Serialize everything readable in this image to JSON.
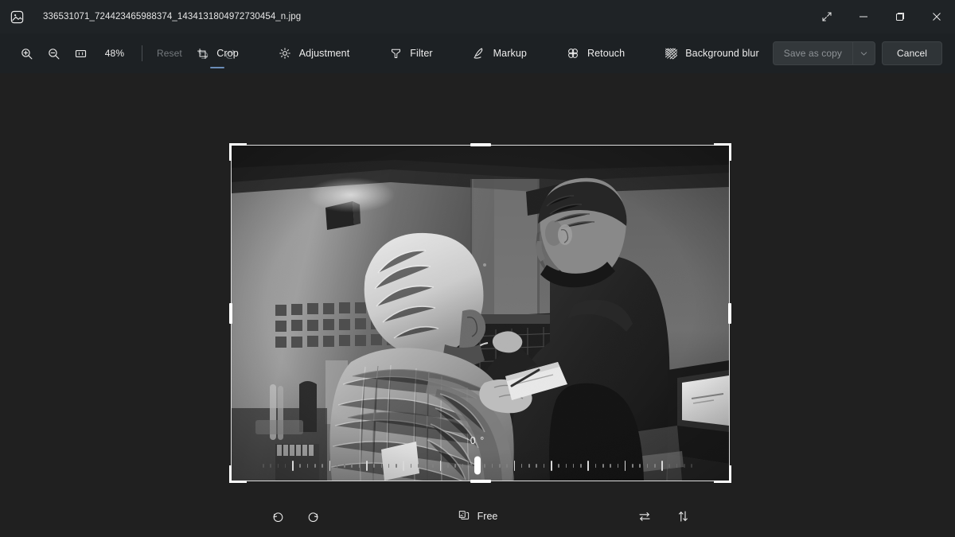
{
  "window": {
    "title": "336531071_724423465988374_1434131804972730454_n.jpg",
    "app_icon": "photo-icon",
    "expand_icon": "expand-diagonal-icon",
    "minimize_label": "─",
    "maximize_label": "❐",
    "close_label": "✕"
  },
  "toolbar": {
    "zoom_in_icon": "zoom-in-icon",
    "zoom_out_icon": "zoom-out-icon",
    "fit_icon": "fit-to-window-icon",
    "zoom_level": "48%",
    "reset_label": "Reset",
    "undo_icon": "undo-icon",
    "redo_icon": "redo-icon",
    "save_as_copy_label": "Save as copy",
    "save_chevron_icon": "chevron-down-icon",
    "cancel_label": "Cancel"
  },
  "tabs": [
    {
      "label": "Crop",
      "icon": "crop-icon",
      "active": true
    },
    {
      "label": "Adjustment",
      "icon": "brightness-icon",
      "active": false
    },
    {
      "label": "Filter",
      "icon": "filter-icon",
      "active": false
    },
    {
      "label": "Markup",
      "icon": "pen-icon",
      "active": false
    },
    {
      "label": "Retouch",
      "icon": "retouch-circles-icon",
      "active": false
    },
    {
      "label": "Background blur",
      "icon": "blur-mesh-icon",
      "active": false
    }
  ],
  "crop": {
    "angle": "0 °",
    "rotate_left_icon": "rotate-left-icon",
    "rotate_right_icon": "rotate-right-icon",
    "aspect_ratio_label": "Free",
    "aspect_ratio_icon": "aspect-ratio-icon",
    "flip_horizontal_icon": "flip-horizontal-icon",
    "flip_vertical_icon": "flip-vertical-icon"
  },
  "colors": {
    "accent": "#6b8db8",
    "titlebar_bg": "#1f2326",
    "toolbar_bg": "#1d2124",
    "canvas_bg": "#202020"
  }
}
